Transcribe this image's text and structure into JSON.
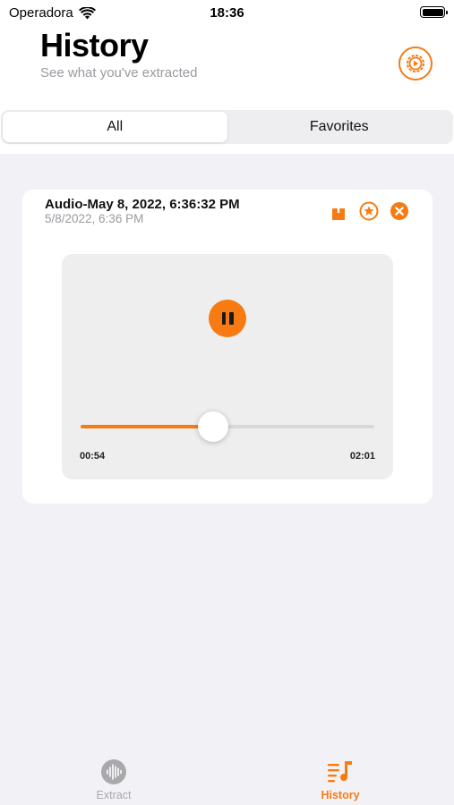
{
  "status_bar": {
    "carrier": "Operadora",
    "time": "18:36"
  },
  "header": {
    "title": "History",
    "subtitle": "See what you've extracted"
  },
  "segments": {
    "all": "All",
    "favorites": "Favorites"
  },
  "card": {
    "title": "Audio-May 8, 2022, 6:36:32 PM",
    "date": "5/8/2022, 6:36 PM"
  },
  "player": {
    "elapsed": "00:54",
    "duration": "02:01",
    "progress": 0.45,
    "state": "playing"
  },
  "tabs": {
    "extract": "Extract",
    "history": "History"
  },
  "colors": {
    "accent": "#f77b12",
    "inactive": "#a8a8ad",
    "background": "#f2f2f6"
  }
}
